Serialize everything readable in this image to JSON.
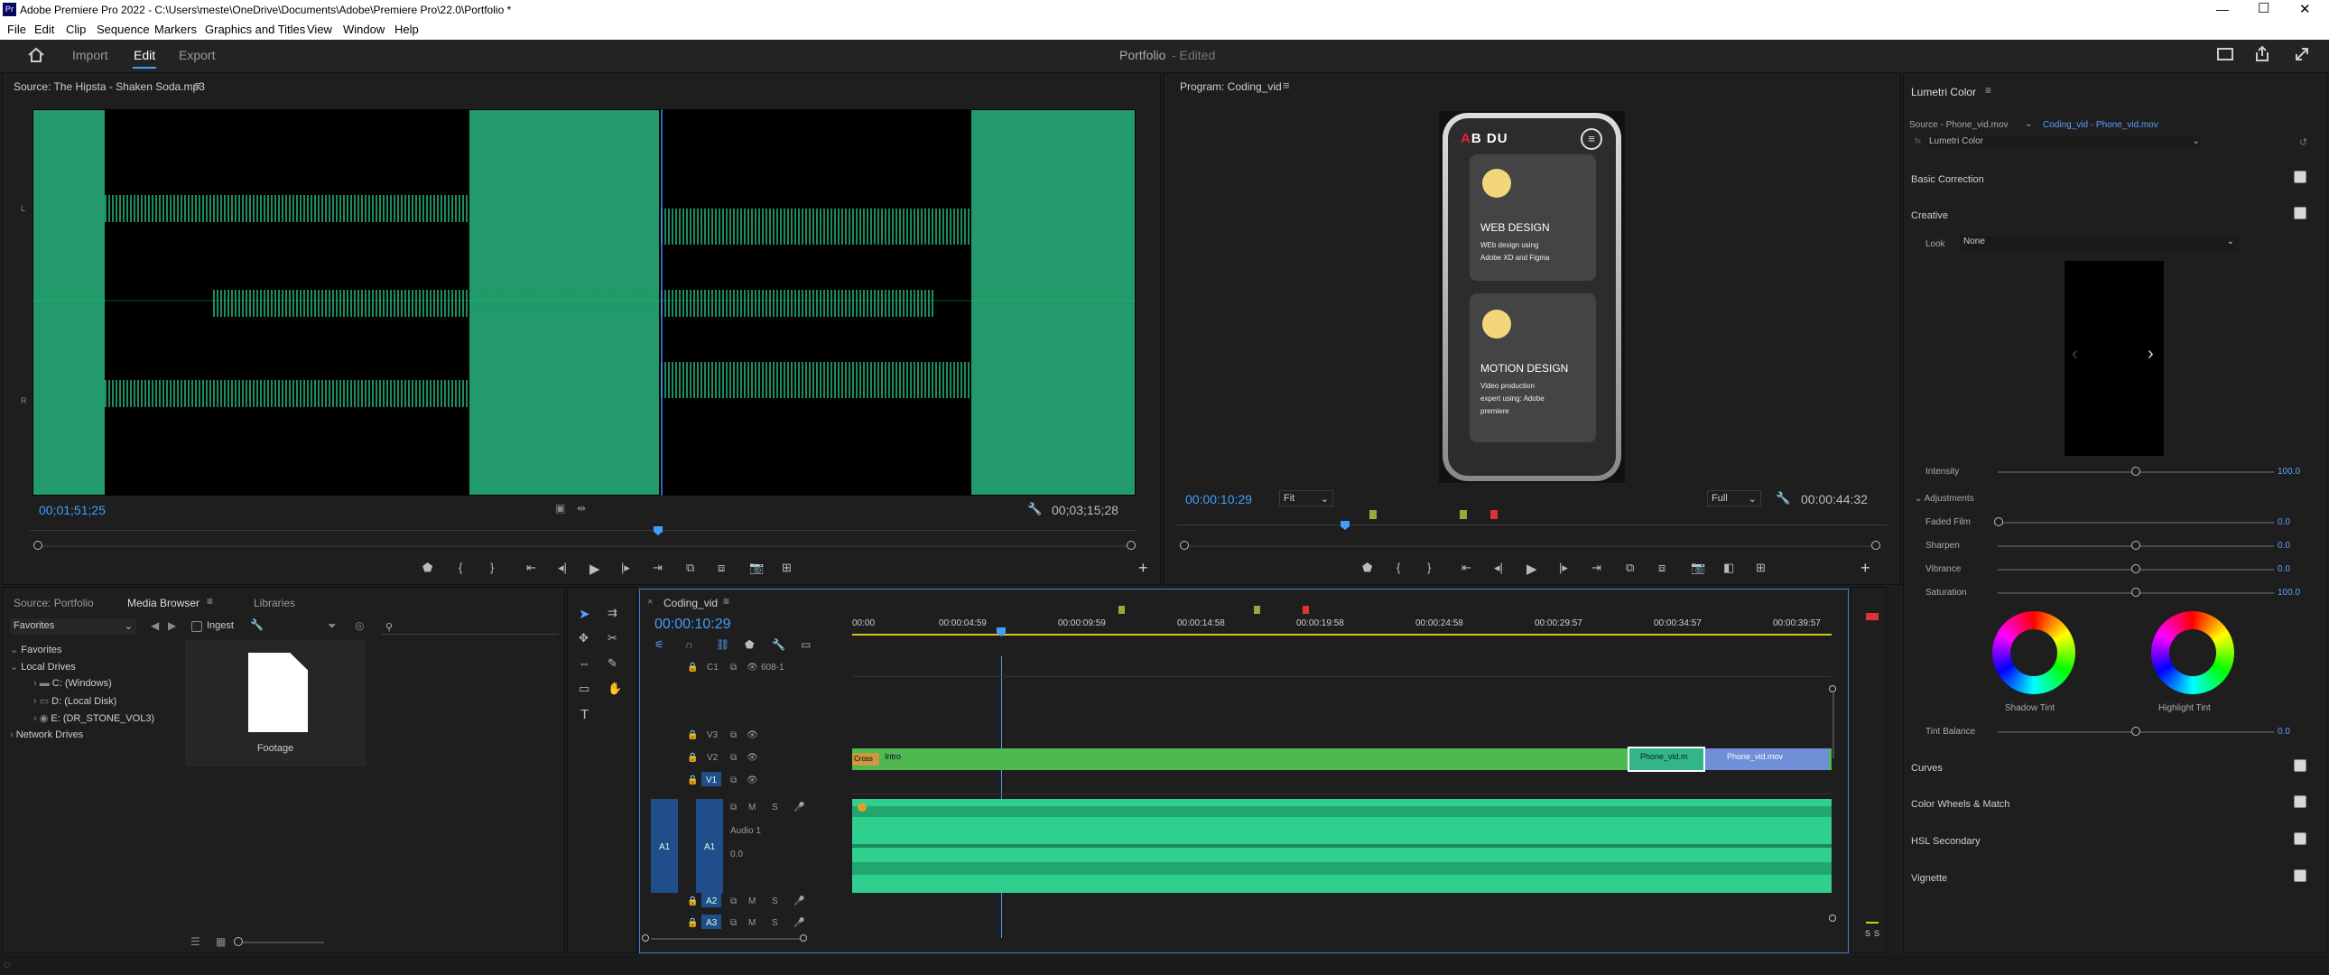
{
  "window": {
    "title": "Adobe Premiere Pro 2022 - C:\\Users\\meste\\OneDrive\\Documents\\Adobe\\Premiere Pro\\22.0\\Portfolio *",
    "app_icon": "Pr"
  },
  "menu": [
    "File",
    "Edit",
    "Clip",
    "Sequence",
    "Markers",
    "Graphics and Titles",
    "View",
    "Window",
    "Help"
  ],
  "workspace": {
    "tabs": [
      "Import",
      "Edit",
      "Export"
    ],
    "active": "Edit",
    "project": "Portfolio",
    "status": "- Edited"
  },
  "source": {
    "title": "Source: The Hipsta - Shaken Soda.mp3",
    "timecode": "00;01;51;25",
    "duration": "00;03;15;28",
    "ch_l": "L",
    "ch_r": "R"
  },
  "program": {
    "title": "Program: Coding_vid",
    "timecode": "00:00:10:29",
    "fit": "Fit",
    "quality": "Full",
    "duration": "00:00:44:32",
    "phone": {
      "logo_a": "A",
      "logo_b": "B",
      "logo_c": "D",
      "logo_d": "U",
      "card1_title": "WEB DESIGN",
      "card1_l1": "WEb design using",
      "card1_l2": "Adobe XD and Figma",
      "card2_title": "MOTION DESIGN",
      "card2_l1": "Video production",
      "card2_l2": "expert using: Adobe",
      "card2_l3": "premiere"
    }
  },
  "project_panel": {
    "tabs": [
      "Source: Portfolio",
      "Media Browser",
      "Libraries"
    ],
    "active": "Media Browser",
    "dropdown": "Favorites",
    "ingest": "Ingest",
    "tree": {
      "favorites": "Favorites",
      "local": "Local Drives",
      "drives": [
        "C: (Windows)",
        "D: (Local Disk)",
        "E: (DR_STONE_VOL3)"
      ],
      "network": "Network Drives"
    },
    "folder": "Footage"
  },
  "timeline": {
    "seq": "Coding_vid",
    "timecode": "00:00:10:29",
    "ruler": [
      "00:00",
      "00:00:04:59",
      "00:00:09:59",
      "00:00:14:58",
      "00:00:19:58",
      "00:00:24:58",
      "00:00:29:57",
      "00:00:34:57",
      "00:00:39:57"
    ],
    "tracks_v": [
      "V3",
      "V2",
      "V1"
    ],
    "tracks_a": [
      "A1",
      "A2",
      "A3"
    ],
    "c1": "C1",
    "c1_label": "608-1",
    "audio_name": "Audio 1",
    "m": "M",
    "s": "S",
    "vol": "0.0",
    "clips": {
      "intro": "Intro",
      "cross": "Cross",
      "phone1": "Phone_vid.m",
      "phone2": "Phone_vid.mov"
    }
  },
  "meter": {
    "s1": "S",
    "s2": "S"
  },
  "lumetri": {
    "title": "Lumetri Color",
    "source": "Source - Phone_vid.mov",
    "target": "Coding_vid - Phone_vid.mov",
    "fx": "Lumetri Color",
    "sections": {
      "basic": "Basic Correction",
      "creative": "Creative",
      "look_label": "Look",
      "look_value": "None",
      "intensity": "Intensity",
      "intensity_val": "100.0",
      "adjust": "Adjustments",
      "faded": "Faded Film",
      "faded_val": "0.0",
      "sharpen": "Sharpen",
      "sharpen_val": "0.0",
      "vibrance": "Vibrance",
      "vibrance_val": "0.0",
      "saturation": "Saturation",
      "saturation_val": "100.0",
      "shadow": "Shadow Tint",
      "highlight": "Highlight Tint",
      "tint": "Tint Balance",
      "tint_val": "0.0",
      "curves": "Curves",
      "wheels": "Color Wheels & Match",
      "hsl": "HSL Secondary",
      "vignette": "Vignette"
    },
    "values": {
      "intensity": 1.0,
      "faded": 0.0,
      "sharpen": 0.5,
      "vibrance": 0.5,
      "saturation": 0.5,
      "tint": 0.5
    }
  },
  "colors": {
    "accent": "#3f9fff",
    "audio": "#2fcf90",
    "video_clip": "#4fb84f",
    "phone_clip": "#6f8fd6"
  }
}
